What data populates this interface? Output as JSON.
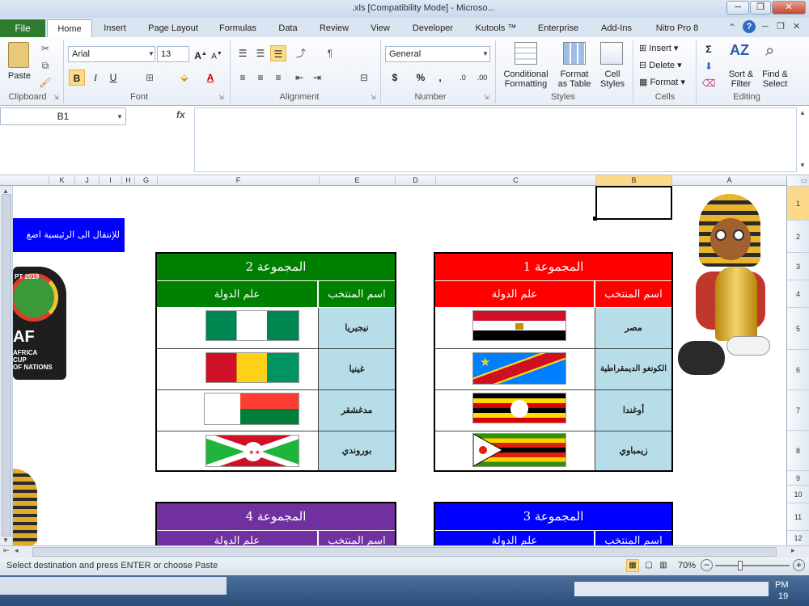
{
  "window": {
    "title": ".xls [Compatibility Mode] - Microso..."
  },
  "tabs": [
    "File",
    "Home",
    "Insert",
    "Page Layout",
    "Formulas",
    "Data",
    "Review",
    "View",
    "Developer",
    "Kutools ™",
    "Enterprise",
    "Add-Ins",
    "Nitro Pro 8"
  ],
  "ribbon": {
    "clipboard": {
      "paste": "Paste",
      "label": "Clipboard"
    },
    "font": {
      "name": "Arial",
      "size": "13",
      "label": "Font",
      "bold": "B",
      "italic": "I",
      "underline": "U"
    },
    "alignment": {
      "label": "Alignment"
    },
    "number": {
      "format": "General",
      "label": "Number",
      "currency": "$",
      "percent": "%",
      "comma": ","
    },
    "styles": {
      "conditional": "Conditional",
      "formatting": "Formatting",
      "format": "Format",
      "as_table": "as Table",
      "cell": "Cell",
      "cell_styles": "Styles",
      "label": "Styles"
    },
    "cells": {
      "insert": "Insert",
      "delete": "Delete",
      "format": "Format",
      "label": "Cells"
    },
    "editing": {
      "sort": "Sort &",
      "filter": "Filter",
      "find": "Find &",
      "select": "Select",
      "label": "Editing"
    }
  },
  "formula_bar": {
    "name_box": "B1",
    "fx": "fx",
    "value": ""
  },
  "columns": [
    "K",
    "J",
    "I",
    "H",
    "G",
    "F",
    "E",
    "D",
    "C",
    "B",
    "A"
  ],
  "rows": [
    "1",
    "2",
    "3",
    "4",
    "5",
    "6",
    "7",
    "8",
    "9",
    "10",
    "11",
    "12"
  ],
  "sheet": {
    "nav_button": "للإنتقال الى الرئيسية اضغ",
    "logo_text": {
      "year": "PT 2019",
      "caf": "AF",
      "line1": "AFRICA",
      "line2": "CUP",
      "line3": "OF NATIONS"
    },
    "groups": [
      {
        "title": "المجموعة 1",
        "col_name": "اسم المنتخب",
        "col_flag": "علم الدولة",
        "color": "#ff0000",
        "countries": [
          "مصر",
          "الكونغو الديمقراطية",
          "أوغندا",
          "زيمباوي"
        ]
      },
      {
        "title": "المجموعة 2",
        "col_name": "اسم المنتخب",
        "col_flag": "علم الدولة",
        "color": "#008000",
        "countries": [
          "نيجيريا",
          "غينيا",
          "مدغشقر",
          "بوروندي"
        ]
      },
      {
        "title": "المجموعة 3",
        "col_name": "اسم المنتخب",
        "col_flag": "علم الدولة",
        "color": "#0000ff"
      },
      {
        "title": "المجموعة 4",
        "col_name": "اسم المنتخب",
        "col_flag": "علم الدولة",
        "color": "#7030a0"
      }
    ]
  },
  "status": {
    "text": "Select destination and press ENTER or choose Paste",
    "zoom": "70%"
  },
  "taskbar": {
    "time": "PM",
    "date": "19"
  }
}
